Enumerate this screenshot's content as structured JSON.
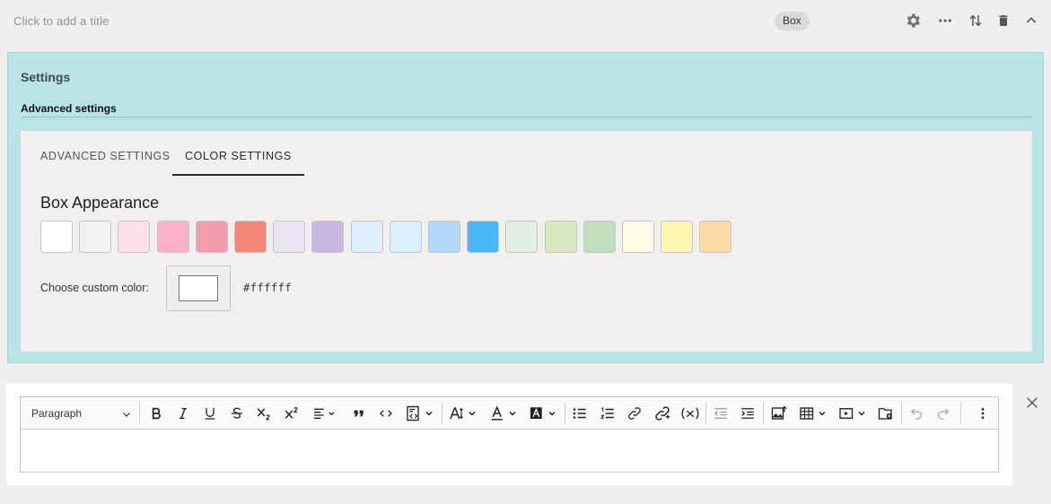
{
  "header": {
    "title_placeholder": "Click to add a title",
    "badge": "Box",
    "icons": [
      "gear-icon",
      "more-horizontal-icon",
      "reorder-icon",
      "trash-icon",
      "chevron-up-icon"
    ]
  },
  "settings": {
    "title": "Settings",
    "section_title": "Advanced settings",
    "tabs": [
      {
        "label": "ADVANCED SETTINGS",
        "active": false
      },
      {
        "label": "COLOR SETTINGS",
        "active": true
      }
    ],
    "box_appearance": {
      "heading": "Box Appearance",
      "swatches": [
        "#ffffff",
        "#f2f2f2",
        "#fde0e8",
        "#f8b1c7",
        "#f39cac",
        "#f4877a",
        "#ebe4f2",
        "#c9b8e2",
        "#deeefa",
        "#dbf0fb",
        "#b3d8fa",
        "#4ab8f6",
        "#e2f0e3",
        "#d8e9c2",
        "#c0dfbf",
        "#fefbe5",
        "#fef7b2",
        "#fdd9a4"
      ]
    },
    "custom_color": {
      "label": "Choose custom color:",
      "value": "#ffffff"
    }
  },
  "editor": {
    "block_format": "Paragraph",
    "toolbar_icons": [
      "bold-icon",
      "italic-icon",
      "underline-icon",
      "strikethrough-icon",
      "subscript-icon",
      "superscript-icon",
      "align-left-icon",
      "blockquote-icon",
      "code-icon",
      "code-block-icon",
      "font-size-icon",
      "font-color-icon",
      "highlight-icon",
      "bulleted-list-icon",
      "numbered-list-icon",
      "link-icon",
      "unlink-icon",
      "formula-icon",
      "outdent-icon",
      "indent-icon",
      "insert-image-icon",
      "table-icon",
      "media-icon",
      "file-manager-icon",
      "undo-icon",
      "redo-icon",
      "more-vertical-icon"
    ],
    "close_icon": "close-icon"
  },
  "colors": {
    "panel_bg": "#bae3e3",
    "inner_bg": "#f1f0ee",
    "page_bg": "#f0efee"
  }
}
